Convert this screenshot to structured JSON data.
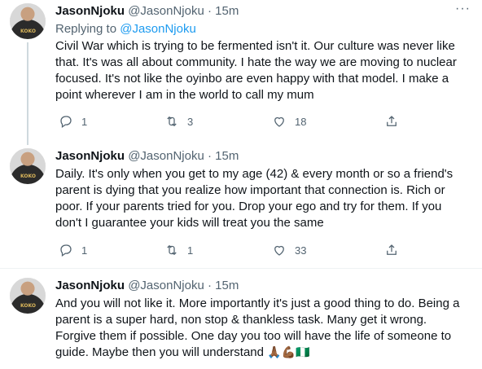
{
  "tweets": [
    {
      "name": "JasonNjoku",
      "handle": "@JasonNjoku",
      "separator": "·",
      "time": "15m",
      "replying_label": "Replying to",
      "replying_to": "@JasonNjoku",
      "text": "Civil War which is trying to be fermented isn't it. Our culture was never like that. It's was all about community. I hate the way we are moving to nuclear focused. It's not like the oyinbo are even happy with that model. I make a point wherever I am in the world to call my mum",
      "replies": "1",
      "retweets": "3",
      "likes": "18"
    },
    {
      "name": "JasonNjoku",
      "handle": "@JasonNjoku",
      "separator": "·",
      "time": "15m",
      "text": "Daily. It's only when you get to my age (42) & every month or so a friend's parent is dying that you realize how important that connection is. Rich or poor. If your parents tried for you. Drop your ego and try for them. If you don't I guarantee your kids will treat you the same",
      "replies": "1",
      "retweets": "1",
      "likes": "33"
    },
    {
      "name": "JasonNjoku",
      "handle": "@JasonNjoku",
      "separator": "·",
      "time": "15m",
      "text": "And you will not like it. More importantly it's just a good thing to do. Being a parent is a super hard, non stop & thankless task. Many get it wrong. Forgive them if possible. One day you too will have the life of someone to guide. Maybe then you will understand",
      "emojis": "🙏🏾💪🏾🇳🇬"
    }
  ],
  "icons": {
    "more": "more-horizontal-icon",
    "reply": "reply-icon",
    "retweet": "retweet-icon",
    "like": "like-icon",
    "share": "share-icon"
  },
  "colors": {
    "accent": "#1d9bf0",
    "secondary_text": "#536471",
    "divider": "#eff3f4"
  }
}
